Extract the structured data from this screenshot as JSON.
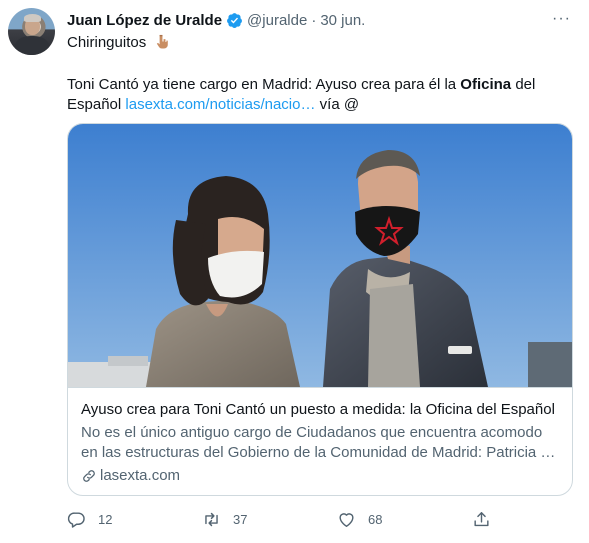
{
  "tweet": {
    "author_name": "Juan López de Uralde",
    "handle": "@juralde",
    "separator": "·",
    "date": "30 jun.",
    "more_label": "···",
    "text_line1": "Chiringuitos",
    "text_line2": "Toni Cantó ya tiene cargo en Madrid: Ayuso crea para él la",
    "text_line2_bold": "Oficina",
    "text_line2_end": "del",
    "text_line3_start": "Español",
    "text_link": "lasexta.com/noticias/nacio…",
    "text_line3_end": "vía @",
    "icons": {
      "verified": "verified-badge-icon",
      "emoji": "backhand-index-pointing-down-emoji",
      "more": "more-options-icon"
    }
  },
  "card": {
    "title": "Ayuso crea para Toni Cantó un puesto a medida: la Oficina del Español",
    "description": "No es el único antiguo cargo de Ciudadanos que encuentra acomodo en las estructuras del Gobierno de la Comunidad de Madrid: Patricia …",
    "domain": "lasexta.com"
  },
  "actions": {
    "replies": "12",
    "retweets": "37",
    "likes": "68"
  },
  "colors": {
    "accent": "#1d9bf0",
    "text": "#0f1419",
    "secondary": "#536471",
    "border": "#cfd9de"
  }
}
